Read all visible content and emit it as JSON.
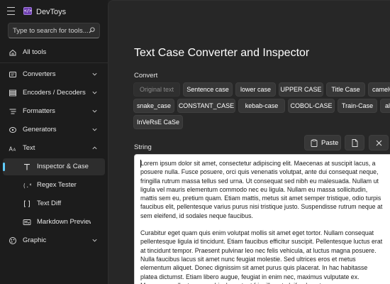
{
  "app": {
    "title": "DevToys",
    "logo_text": "</>"
  },
  "search": {
    "placeholder": "Type to search for tools..."
  },
  "sidebar": {
    "items": [
      {
        "label": "All tools",
        "icon": "home-icon"
      },
      {
        "label": "Converters",
        "icon": "converters-icon"
      },
      {
        "label": "Encoders / Decoders",
        "icon": "encoders-icon"
      },
      {
        "label": "Formatters",
        "icon": "formatters-icon"
      },
      {
        "label": "Generators",
        "icon": "generators-icon"
      },
      {
        "label": "Text",
        "icon": "text-icon"
      },
      {
        "label": "Inspector & Case",
        "icon": "text-case-icon"
      },
      {
        "label": "Regex Tester",
        "icon": "regex-icon"
      },
      {
        "label": "Text Diff",
        "icon": "text-diff-icon"
      },
      {
        "label": "Markdown Preview",
        "icon": "markdown-icon"
      },
      {
        "label": "Graphic",
        "icon": "graphic-icon"
      }
    ]
  },
  "main": {
    "title": "Text Case Converter and Inspector",
    "convert_label": "Convert",
    "chips": [
      "Original text",
      "Sentence case",
      "lower case",
      "UPPER CASE",
      "Title Case",
      "camelCase",
      "snake_case",
      "CONSTANT_CASE",
      "kebab-case",
      "COBOL-CASE",
      "Train-Case",
      "alternating case",
      "InVeRsE CaSe"
    ],
    "string_label": "String",
    "paste_label": "Paste",
    "text_paragraphs": [
      "Lorem ipsum dolor sit amet, consectetur adipiscing elit. Maecenas at suscipit lacus, a posuere nulla. Fusce posuere, orci quis venenatis volutpat, ante dui consequat neque, fringilla rutrum massa tellus sed urna. Ut consequat sed nibh eu malesuada. Nullam ut ligula vel mauris elementum commodo nec eu ligula. Nullam eu massa sollicitudin, mattis sem eu, pretium quam. Etiam mattis, metus sit amet semper tristique, odio turpis faucibus elit, pellentesque varius purus nisi tristique justo. Suspendisse rutrum neque at sem eleifend, id sodales neque faucibus.",
      "Curabitur eget quam quis enim volutpat mollis sit amet eget tortor. Nullam consequat pellentesque ligula id tincidunt. Etiam faucibus efficitur suscipit. Pellentesque luctus erat at tincidunt tempor. Praesent pulvinar leo nec felis vehicula, at luctus magna posuere. Nulla faucibus lacus sit amet nunc feugiat molestie. Sed ultrices eros et metus elementum aliquet. Donec dignissim sit amet purus quis placerat. In hac habitasse platea dictumst. Etiam libero augue, feugiat in enim nec, maximus vulputate ex. Maecenas pellentesque vehicula erat, et fringilla est eleifend eget."
    ]
  },
  "colors": {
    "accent": "#60cdff",
    "sidebar_bg": "#1c1c1c",
    "main_bg": "#272727",
    "chip_bg": "#373737"
  }
}
